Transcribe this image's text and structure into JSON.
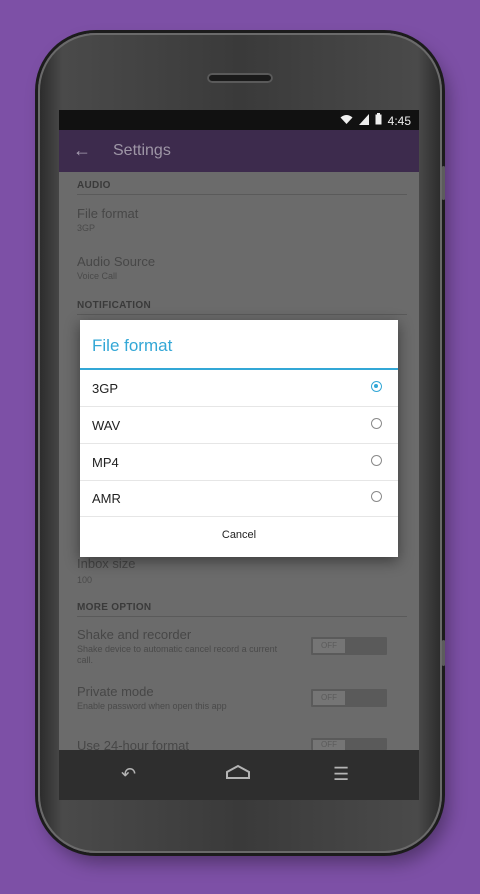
{
  "status_bar": {
    "time": "4:45"
  },
  "app_bar": {
    "title": "Settings",
    "back_icon": "arrow-left-icon"
  },
  "sections": {
    "audio": {
      "header": "AUDIO"
    },
    "notification": {
      "header": "NOTIFICATION"
    },
    "more_option": {
      "header": "MORE OPTION"
    }
  },
  "prefs": {
    "file_format": {
      "title": "File format",
      "summary": "3GP"
    },
    "audio_source": {
      "title": "Audio Source",
      "summary": "Voice Call"
    },
    "inbox_size": {
      "title": "Inbox size",
      "summary": "100"
    },
    "shake": {
      "title": "Shake and recorder",
      "summary": "Shake device to automatic cancel record a current call.",
      "toggle": "OFF"
    },
    "private_mode": {
      "title": "Private mode",
      "summary": "Enable password when open this app",
      "toggle": "OFF"
    },
    "hour24": {
      "title": "Use 24-hour format",
      "toggle": "OFF"
    }
  },
  "dialog": {
    "title": "File format",
    "options": [
      {
        "label": "3GP",
        "checked": true
      },
      {
        "label": "WAV",
        "checked": false
      },
      {
        "label": "MP4",
        "checked": false
      },
      {
        "label": "AMR",
        "checked": false
      }
    ],
    "cancel_label": "Cancel"
  },
  "colors": {
    "accent": "#33a7d6",
    "appbar": "#3d2b4d",
    "background": "#7d50a6"
  }
}
